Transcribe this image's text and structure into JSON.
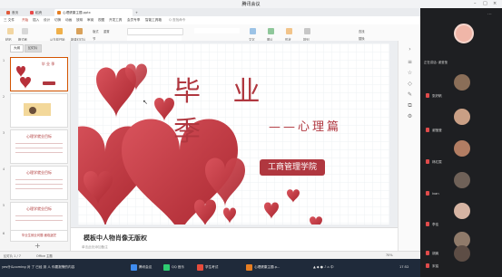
{
  "window": {
    "title": "腾讯会议"
  },
  "wps": {
    "tabs": [
      "首页",
      "稻壳",
      "心理健康主题.pptx"
    ],
    "menus": [
      "三 文件",
      "开始",
      "插入",
      "设计",
      "切换",
      "动画",
      "放映",
      "审阅",
      "视图",
      "开发工具",
      "会员专享",
      "智能工具箱"
    ],
    "search": "Q 查找命令",
    "ribbon": [
      "粘贴",
      "格式刷",
      "从当前开始",
      "新建幻灯片",
      "版式",
      "节",
      "重置",
      "文字",
      "图片",
      "形状",
      "排列",
      "查找",
      "替换"
    ],
    "pane_tabs": [
      "大纲",
      "幻灯片"
    ]
  },
  "thumbs": [
    {
      "num": "1",
      "title": "毕 业 季"
    },
    {
      "num": "2",
      "title": ""
    },
    {
      "num": "3",
      "title": "心理学就业目标"
    },
    {
      "num": "4",
      "title": "心理学就业目标"
    },
    {
      "num": "5",
      "title": "心理学就业目标"
    },
    {
      "num": "6",
      "title": "毕业生就业问题 面临迷茫"
    }
  ],
  "slide": {
    "title": "毕 业 季",
    "subtitle": "——心理篇",
    "badge": "工商管理学院",
    "watermark": "模板中人物肖像无版权",
    "notes_placeholder": "单击此处添加备注"
  },
  "status": {
    "left": "幻灯片 1 / 7",
    "mid": "Office 主题",
    "zoom": "70%"
  },
  "taskbar": {
    "left_text": "yes什么coming 对 了 已经 到 人 你要报警的内容",
    "items": [
      "腾讯会议",
      "QQ 音乐",
      "学生考试",
      "心理健康主题.p..."
    ],
    "time": "17:52"
  },
  "participants": {
    "speaking": "正在讲话: 谢莹莹",
    "people": [
      {
        "name": "",
        "color": "#f0b6a8"
      },
      {
        "name": "张好帆",
        "color": "#8a6e58"
      },
      {
        "name": "谢莹莹",
        "color": "#c99f85"
      },
      {
        "name": "林红雯",
        "color": "#b27d63"
      },
      {
        "name": "ivan",
        "color": "#6f6158"
      },
      {
        "name": "李佳",
        "color": "#d6b4a3"
      },
      {
        "name": "胡爽",
        "color": "#8f7a6a"
      },
      {
        "name": "宋铭",
        "color": "#5d4d45"
      }
    ]
  },
  "colors": {
    "accent": "#b0373f",
    "heart": "#b8303a",
    "heart_light": "#d9535c"
  }
}
